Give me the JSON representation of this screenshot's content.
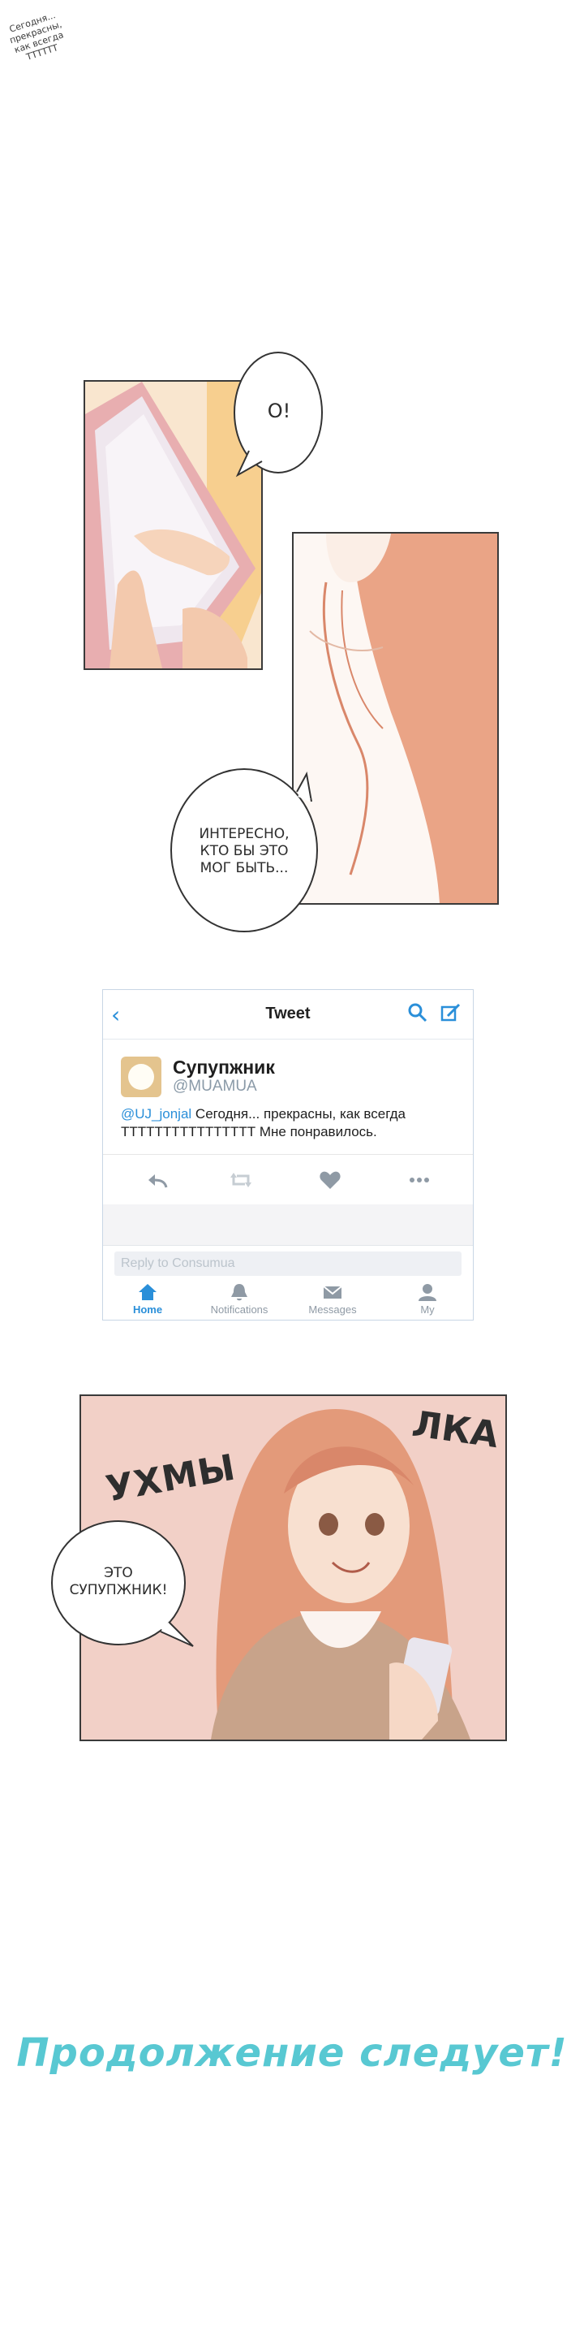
{
  "panel1": {
    "phone_text": "Сегодня...\nпрекрасны,\nкак всегда\nТТТТТТ"
  },
  "bubble1": {
    "text": "О!"
  },
  "bubble2": {
    "text": "ИНТЕРЕСНО,\nКТО БЫ ЭТО\nМОГ БЫТЬ..."
  },
  "tweet": {
    "title": "Tweet",
    "back_icon": "chevron-left-icon",
    "name": "Супупжник",
    "handle": "@MUAMUA",
    "mention": "@UJ_jonjal",
    "body_text": "Сегодня... прекрасны, как всегда\nТТТТТТТТТТТТТТТТ Мне понравилось.",
    "reply_placeholder": "Reply to Consumua",
    "tabs": [
      "Home",
      "Notifications",
      "Messages",
      "My"
    ],
    "accent": "#2a8fd9"
  },
  "panel3": {
    "sfx_left": "УХМЫ",
    "sfx_right": "ЛКА"
  },
  "bubble3": {
    "text": "ЭТО\nСУПУПЖНИК!"
  },
  "footer": {
    "continued": "Продолжение следует!"
  }
}
